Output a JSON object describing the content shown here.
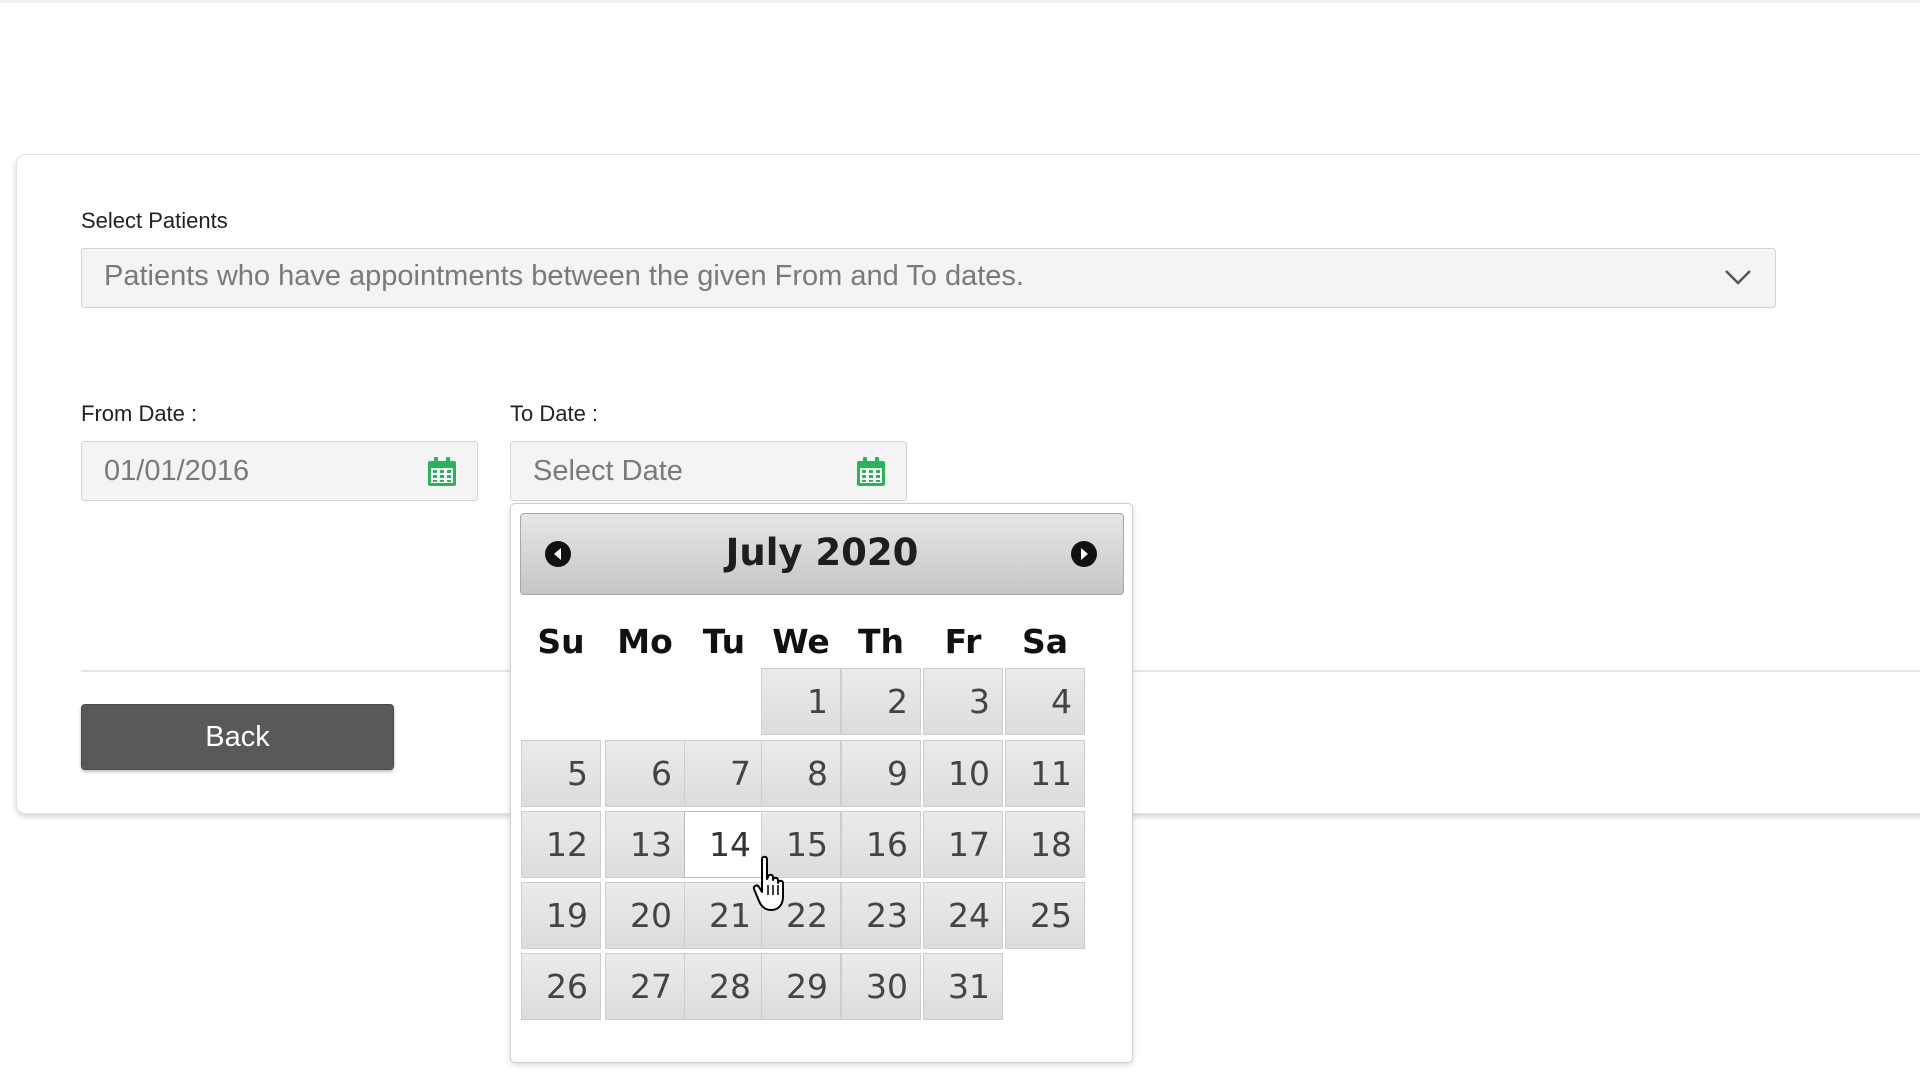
{
  "form": {
    "select_patients_label": "Select Patients",
    "select_patients_value": "Patients who have appointments between the given From and To dates.",
    "from_date_label": "From Date :",
    "from_date_value": "01/01/2016",
    "to_date_label": "To Date :",
    "to_date_placeholder": "Select Date",
    "back_label": "Back"
  },
  "datepicker": {
    "title": "July 2020",
    "weekdays": [
      "Su",
      "Mo",
      "Tu",
      "We",
      "Th",
      "Fr",
      "Sa"
    ],
    "days": [
      "1",
      "2",
      "3",
      "4",
      "5",
      "6",
      "7",
      "8",
      "9",
      "10",
      "11",
      "12",
      "13",
      "14",
      "15",
      "16",
      "17",
      "18",
      "19",
      "20",
      "21",
      "22",
      "23",
      "24",
      "25",
      "26",
      "27",
      "28",
      "29",
      "30",
      "31"
    ],
    "first_weekday_index": 3,
    "highlighted_day": "14"
  },
  "colors": {
    "calendar_icon": "#2bb35b",
    "button_bg": "#595959"
  },
  "icons": {
    "calendar": "calendar-icon",
    "dropdown": "chevron-down-icon",
    "prev": "chevron-left-circle-icon",
    "next": "chevron-right-circle-icon",
    "cursor": "hand-pointer-icon"
  }
}
